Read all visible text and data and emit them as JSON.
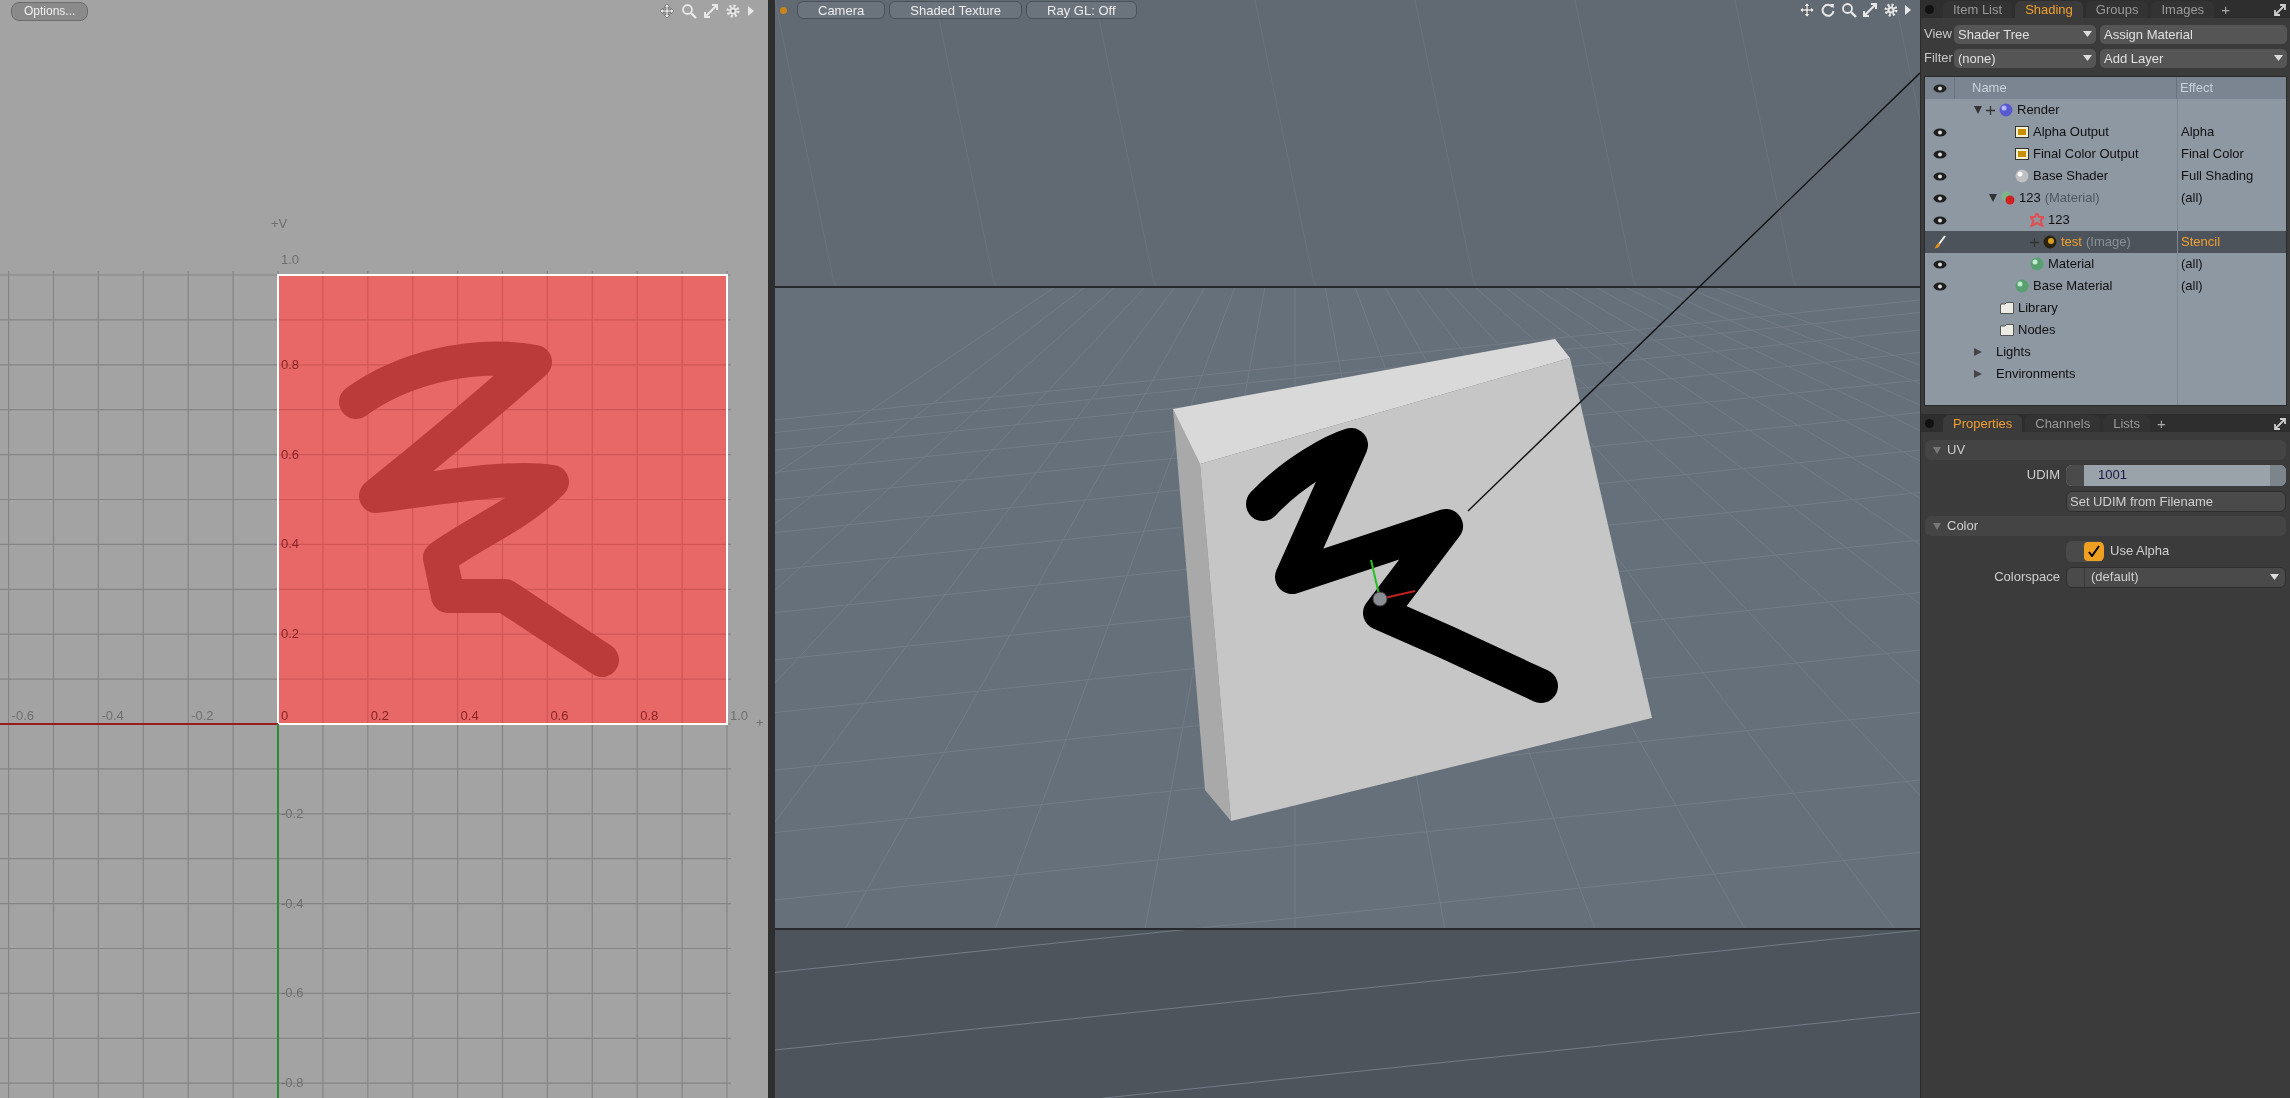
{
  "uv_editor": {
    "options_button": "Options...",
    "v_axis_label": "+V",
    "u_axis_label": "+",
    "u_ticks": [
      "-0.6",
      "-0.4",
      "-0.2",
      "0",
      "0.2",
      "0.4",
      "0.6",
      "0.8",
      "1.0"
    ],
    "v_ticks": [
      "1.0",
      "0.8",
      "0.6",
      "0.4",
      "0.2",
      "-0.2",
      "-0.4",
      "-0.6",
      "-0.8"
    ]
  },
  "viewport": {
    "buttons": [
      "Camera",
      "Shaded Texture",
      "Ray GL: Off"
    ]
  },
  "shading_panel": {
    "tabs": [
      {
        "label": "Item List",
        "selected": false
      },
      {
        "label": "Shading",
        "selected": true
      },
      {
        "label": "Groups",
        "selected": false
      },
      {
        "label": "Images",
        "selected": false
      }
    ],
    "add_tab": "+",
    "view_label": "View",
    "view_value": "Shader Tree",
    "assign_button": "Assign Material",
    "filter_label": "Filter",
    "filter_value": "(none)",
    "add_layer": "Add Layer",
    "columns": [
      "Name",
      "Effect"
    ],
    "tree": [
      {
        "name": "Render",
        "kind": "render",
        "visible": false,
        "paint_layer": false,
        "expanded": true,
        "plus": true,
        "selected": false,
        "children": [
          {
            "name": "Alpha Output",
            "effect": "Alpha",
            "kind": "output",
            "visible": true,
            "paint_layer": false,
            "plus": false,
            "selected": false
          },
          {
            "name": "Final Color Output",
            "effect": "Final Color",
            "kind": "output",
            "visible": true,
            "paint_layer": false,
            "plus": false,
            "selected": false
          },
          {
            "name": "Base Shader",
            "effect": "Full Shading",
            "kind": "shader",
            "visible": true,
            "paint_layer": false,
            "plus": false,
            "selected": false
          },
          {
            "name": "123",
            "suffix": "(Material)",
            "effect": "(all)",
            "kind": "material-group",
            "visible": true,
            "paint_layer": false,
            "expanded": true,
            "plus": false,
            "selected": false,
            "children": [
              {
                "name": "123",
                "kind": "locator",
                "visible": true,
                "paint_layer": false,
                "plus": false,
                "selected": false
              },
              {
                "name": "test",
                "suffix": "(Image)",
                "effect": "Stencil",
                "kind": "image",
                "visible": false,
                "paint_layer": true,
                "plus": true,
                "selected": true
              },
              {
                "name": "Material",
                "effect": "(all)",
                "kind": "material",
                "visible": true,
                "paint_layer": false,
                "plus": false,
                "selected": false
              }
            ]
          },
          {
            "name": "Base Material",
            "effect": "(all)",
            "kind": "material",
            "visible": true,
            "paint_layer": false,
            "plus": false,
            "selected": false
          }
        ]
      },
      {
        "name": "Library",
        "kind": "folder",
        "visible": false,
        "paint_layer": false,
        "plus": false,
        "selected": false
      },
      {
        "name": "Nodes",
        "kind": "folder",
        "visible": false,
        "paint_layer": false,
        "plus": false,
        "selected": false
      },
      {
        "name": "Lights",
        "kind": "group",
        "visible": false,
        "paint_layer": false,
        "expanded": false,
        "plus": false,
        "selected": false
      },
      {
        "name": "Environments",
        "kind": "group",
        "visible": false,
        "paint_layer": false,
        "expanded": false,
        "plus": false,
        "selected": false
      }
    ]
  },
  "properties_panel": {
    "tabs": [
      {
        "label": "Properties",
        "selected": true
      },
      {
        "label": "Channels",
        "selected": false
      },
      {
        "label": "Lists",
        "selected": false
      }
    ],
    "add_tab": "+",
    "sections": [
      {
        "title": "UV",
        "expanded": true,
        "rows": [
          {
            "kind": "number",
            "label": "UDIM",
            "value": "1001"
          },
          {
            "kind": "button",
            "label": "Set UDIM from Filename"
          }
        ]
      },
      {
        "title": "Color",
        "expanded": true,
        "rows": [
          {
            "kind": "checkbox",
            "label": "Use Alpha",
            "checked": true
          },
          {
            "kind": "dropdown",
            "label": "Colorspace",
            "value": "(default)"
          }
        ]
      }
    ]
  }
}
